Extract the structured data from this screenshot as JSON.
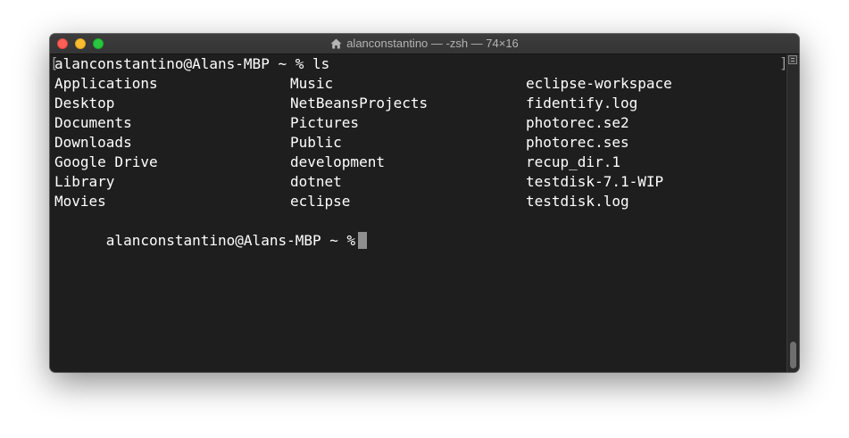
{
  "window": {
    "title": "alanconstantino — -zsh — 74×16",
    "traffic_lights": [
      "close",
      "minimize",
      "zoom"
    ]
  },
  "terminal": {
    "prompt_command": "alanconstantino@Alans-MBP ~ % ls",
    "listing_rows": [
      [
        "Applications",
        "Music",
        "eclipse-workspace"
      ],
      [
        "Desktop",
        "NetBeansProjects",
        "fidentify.log"
      ],
      [
        "Documents",
        "Pictures",
        "photorec.se2"
      ],
      [
        "Downloads",
        "Public",
        "photorec.ses"
      ],
      [
        "Google Drive",
        "development",
        "recup_dir.1"
      ],
      [
        "Library",
        "dotnet",
        "testdisk-7.1-WIP"
      ],
      [
        "Movies",
        "eclipse",
        "testdisk.log"
      ]
    ],
    "final_prompt": "alanconstantino@Alans-MBP ~ %",
    "colors": {
      "background": "#1e1e1e",
      "text": "#ffffff",
      "cursor": "#8f8f8f"
    }
  }
}
